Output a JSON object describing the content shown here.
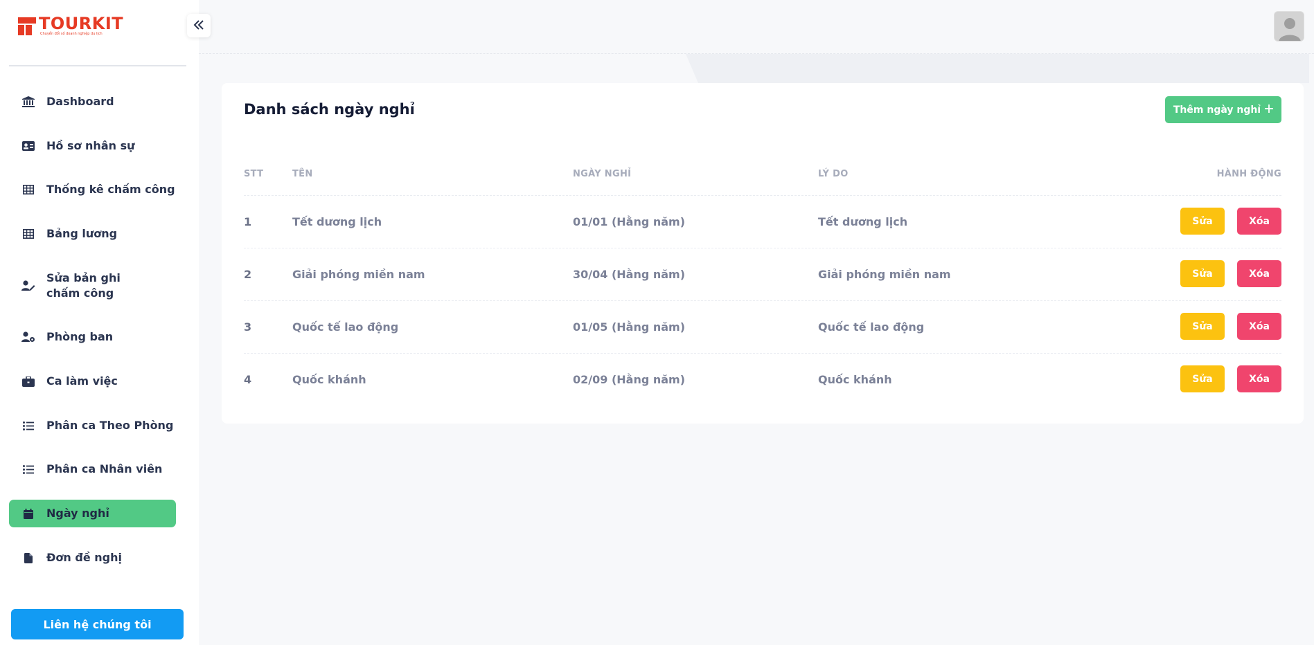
{
  "brand": {
    "name": "TOURKIT",
    "tagline": "Chuyển đổi số doanh nghiệp du lịch"
  },
  "sidebar": {
    "items": [
      {
        "label": "Dashboard",
        "icon": "bank-icon",
        "active": false
      },
      {
        "label": "Hồ sơ nhân sự",
        "icon": "id-card-icon",
        "active": false
      },
      {
        "label": "Thống kê chấm công",
        "icon": "grid-table-icon",
        "active": false
      },
      {
        "label": "Bảng lương",
        "icon": "grid-table-icon",
        "active": false
      },
      {
        "label": "Sửa bản ghi chấm công",
        "icon": "user-edit-icon",
        "active": false
      },
      {
        "label": "Phòng ban",
        "icon": "user-gear-icon",
        "active": false
      },
      {
        "label": "Ca làm việc",
        "icon": "briefcase-icon",
        "active": false
      },
      {
        "label": "Phân ca Theo Phòng",
        "icon": "list-icon",
        "active": false
      },
      {
        "label": "Phân ca Nhân viên",
        "icon": "list-icon",
        "active": false
      },
      {
        "label": "Ngày nghỉ",
        "icon": "calendar-icon",
        "active": true
      },
      {
        "label": "Đơn đề nghị",
        "icon": "file-icon",
        "active": false
      }
    ],
    "contact_label": "Liên hệ chúng tôi"
  },
  "main": {
    "title": "Danh sách ngày nghỉ",
    "add_button_label": "Thêm ngày nghỉ",
    "table": {
      "headers": {
        "stt": "STT",
        "name": "TÊN",
        "date": "NGÀY NGHỈ",
        "reason": "LÝ DO",
        "actions": "HÀNH ĐỘNG"
      },
      "edit_label": "Sửa",
      "delete_label": "Xóa",
      "rows": [
        {
          "stt": "1",
          "name": "Tết dương lịch",
          "date": "01/01 (Hằng năm)",
          "reason": "Tết dương lịch"
        },
        {
          "stt": "2",
          "name": "Giải phóng miền nam",
          "date": "30/04 (Hằng năm)",
          "reason": "Giải phóng miền nam"
        },
        {
          "stt": "3",
          "name": "Quốc tế lao động",
          "date": "01/05 (Hằng năm)",
          "reason": "Quốc tế lao động"
        },
        {
          "stt": "4",
          "name": "Quốc khánh",
          "date": "02/09 (Hằng năm)",
          "reason": "Quốc khánh"
        }
      ]
    }
  },
  "colors": {
    "accent_green": "#52c985",
    "edit_yellow": "#fcc210",
    "delete_red": "#f0456d",
    "contact_blue": "#129bf3",
    "brand_red": "#e63a24"
  }
}
